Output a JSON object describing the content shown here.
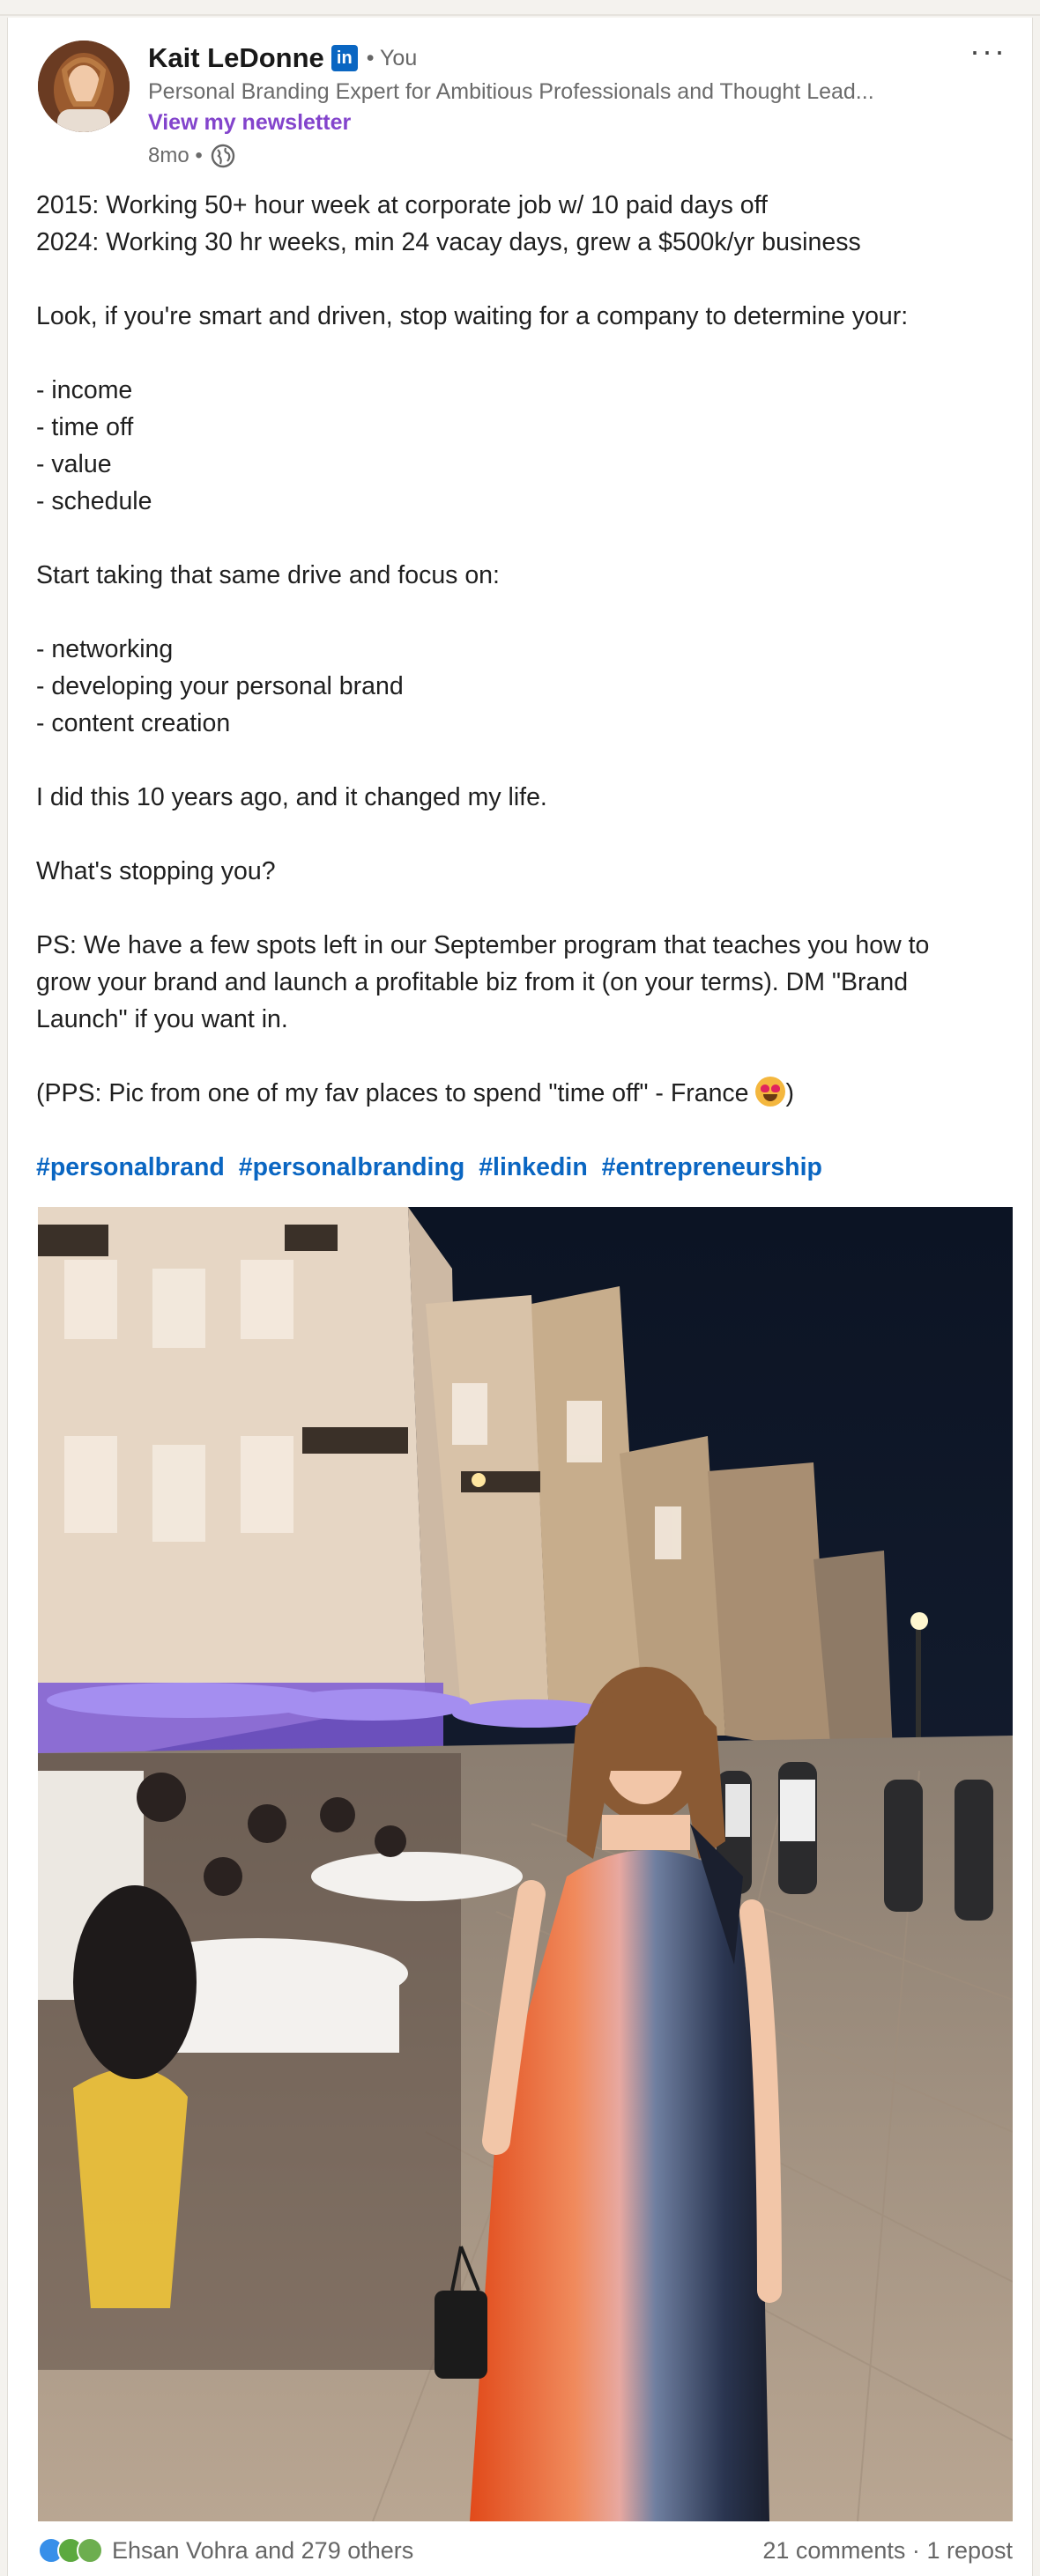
{
  "post": {
    "author": {
      "name": "Kait LeDonne",
      "badge": "in",
      "relation": "• You",
      "headline": "Personal Branding Expert for Ambitious Professionals and Thought Lead...",
      "newsletter_link": "View my newsletter",
      "time": "8mo •"
    },
    "body_lines": [
      "2015: Working 50+ hour week at corporate job w/ 10 paid days off",
      "2024: Working 30 hr weeks, min 24 vacay days, grew a $500k/yr business",
      "",
      "Look, if you're smart and driven, stop waiting for a company to determine your:",
      "",
      "- income",
      "- time off",
      "- value",
      "- schedule",
      "",
      "Start taking that same drive and focus on:",
      "",
      "- networking",
      "- developing your personal brand",
      "- content creation",
      "",
      "I did this 10 years ago, and it changed my life.",
      "",
      "What's stopping you?",
      "",
      "PS: We have a few spots left in our September program that teaches you how to",
      "grow your brand and launch a profitable biz from it (on your terms). DM \"Brand",
      "Launch\" if you want in.",
      "",
      "(PPS: Pic from one of my fav places to spend \"time off\" - France",
      ")"
    ],
    "hashtags": [
      "#personalbrand",
      "#personalbranding",
      "#linkedin",
      "#entrepreneurship"
    ],
    "reactions_text": "Ehsan Vohra and 279 others",
    "comments_text": "21 comments",
    "separator": "·",
    "reposts_text": "1 repost",
    "more_label": "···"
  },
  "colors": {
    "link_blue": "#0a66c2",
    "newsletter_purple": "#8344cc",
    "text": "#1f1f1f",
    "muted": "#666666"
  },
  "icons": [
    "linkedin-badge-icon",
    "globe-icon",
    "more-options-icon",
    "like-reaction-icon",
    "celebrate-reaction-icon",
    "support-reaction-icon",
    "heart-eyes-emoji"
  ]
}
